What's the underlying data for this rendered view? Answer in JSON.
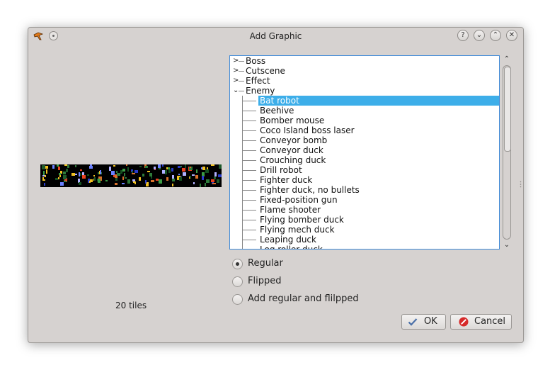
{
  "window": {
    "title": "Add Graphic"
  },
  "titlebar": {
    "app_icon": "app-logo-icon",
    "buttons": [
      "help-icon",
      "minimize-icon",
      "maximize-icon",
      "close-icon"
    ],
    "help_glyph": "?",
    "min_glyph": "⌄",
    "max_glyph": "⌃",
    "close_glyph": "✕"
  },
  "preview": {
    "tile_count_label": "20 tiles"
  },
  "tree": {
    "categories": [
      {
        "label": "Boss",
        "expanded": false
      },
      {
        "label": "Cutscene",
        "expanded": false
      },
      {
        "label": "Effect",
        "expanded": false
      },
      {
        "label": "Enemy",
        "expanded": true
      }
    ],
    "expand_glyph": ">",
    "collapse_glyph": "⌄",
    "enemy_children": [
      "Bat robot",
      "Beehive",
      "Bomber mouse",
      "Coco Island boss laser",
      "Conveyor bomb",
      "Conveyor duck",
      "Crouching duck",
      "Drill robot",
      "Fighter duck",
      "Fighter duck, no bullets",
      "Fixed-position gun",
      "Flame shooter",
      "Flying bomber duck",
      "Flying mech duck",
      "Leaping duck",
      "Log roller duck"
    ],
    "selected": "Bat robot"
  },
  "options": {
    "regular": "Regular",
    "flipped": "Flipped",
    "both": "Add regular and flilpped",
    "selected": "Regular"
  },
  "buttons": {
    "ok": "OK",
    "cancel": "Cancel"
  },
  "colors": {
    "selection": "#3daee9",
    "focus_border": "#3d8ad9",
    "cancel_icon": "#d62a2a",
    "ok_icon": "#4a6fa8"
  }
}
